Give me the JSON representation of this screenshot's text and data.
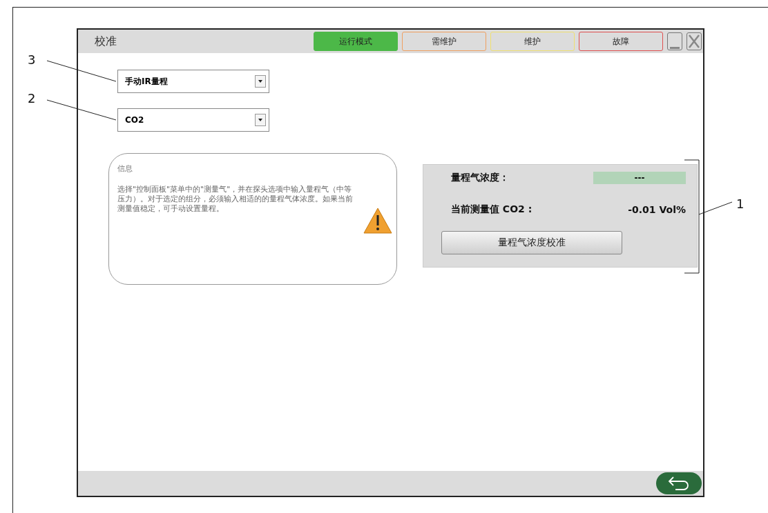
{
  "callouts": [
    {
      "label": "3"
    },
    {
      "label": "2"
    },
    {
      "label": "1"
    }
  ],
  "window": {
    "title": "校准"
  },
  "status_buttons": [
    {
      "label": "运行模式",
      "color": "#4cb848",
      "selected": true
    },
    {
      "label": "需维护",
      "color": "#f0a060",
      "selected": false
    },
    {
      "label": "维护",
      "color": "#f0e070",
      "selected": false
    },
    {
      "label": "故障",
      "color": "#e05050",
      "selected": false
    }
  ],
  "dropdowns": [
    {
      "value": "手动IR量程"
    },
    {
      "value": "CO2"
    }
  ],
  "info": {
    "title": "信息",
    "text": "选择\"控制面板\"菜单中的\"测量气\"，并在探头选项中输入量程气（中等压力）。对于选定的组分，必须输入相适的的量程气体浓度。如果当前测量值稳定，可手动设置量程。"
  },
  "panel": {
    "span_label": "量程气浓度：",
    "span_value": "---",
    "current_label": "当前测量值 CO2 :",
    "current_value": "-0.01 Vol%",
    "button": "量程气浓度校准"
  }
}
